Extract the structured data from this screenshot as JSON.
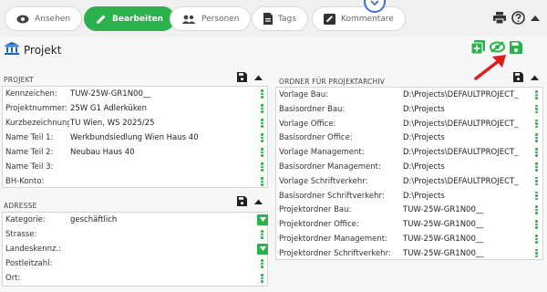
{
  "toolbar": {
    "tabs": [
      {
        "label": "Ansehen",
        "icon": "eye-icon"
      },
      {
        "label": "Bearbeiten",
        "icon": "pencil-icon",
        "active": true
      },
      {
        "label": "Personen",
        "icon": "people-icon"
      },
      {
        "label": "Tags",
        "icon": "document-icon"
      },
      {
        "label": "Kommentare",
        "icon": "comment-icon"
      }
    ],
    "right_icons": [
      "print-icon",
      "help-icon",
      "caret-up-icon"
    ]
  },
  "page": {
    "title": "Projekt",
    "title_icon": "institution-icon",
    "actions": [
      "add-icon",
      "hide-icon",
      "save-icon"
    ]
  },
  "projekt": {
    "header": "PROJEKT",
    "fields": [
      {
        "label": "Kennzeichen:",
        "value": "TUW-25W-GR1N00__"
      },
      {
        "label": "Projektnummer:",
        "value": "25W G1 Adlerküken"
      },
      {
        "label": "Kurzbezeichnung:",
        "value": "TU Wien, WS 2025/25"
      },
      {
        "label": "Name Teil 1:",
        "value": "Werkbundsiedlung Wien Haus 40"
      },
      {
        "label": "Name Teil 2:",
        "value": "Neubau Haus 40"
      },
      {
        "label": "Name Teil 3:",
        "value": ""
      },
      {
        "label": "BH-Konto:",
        "value": ""
      }
    ]
  },
  "adresse": {
    "header": "ADRESSE",
    "fields": [
      {
        "label": "Kategorie:",
        "value": "geschäftlich"
      },
      {
        "label": "Strasse:",
        "value": ""
      },
      {
        "label": "Landeskennz.:",
        "value": ""
      },
      {
        "label": "Postleitzahl:",
        "value": ""
      },
      {
        "label": "Ort:",
        "value": ""
      }
    ]
  },
  "ordner": {
    "header": "ORDNER FÜR PROJEKTARCHIV",
    "fields": [
      {
        "label": "Vorlage Bau:",
        "value": "D:\\Projects\\DEFAULTPROJECT_"
      },
      {
        "label": "Basisordner Bau:",
        "value": "D:\\Projects"
      },
      {
        "label": "Vorlage Office:",
        "value": "D:\\Projects\\DEFAULTPROJECT_"
      },
      {
        "label": "Basisordner Office:",
        "value": "D:\\Projects"
      },
      {
        "label": "Vorlage Management:",
        "value": "D:\\Projects\\DEFAULTPROJECT_"
      },
      {
        "label": "Basisordner Management:",
        "value": "D:\\Projects"
      },
      {
        "label": "Vorlage Schriftverkehr:",
        "value": "D:\\Projects\\DEFAULTPROJECT_"
      },
      {
        "label": "Basisordner Schriftverkehr:",
        "value": "D:\\Projects"
      },
      {
        "label": "Projektordner Bau:",
        "value": "TUW-25W-GR1N00__"
      },
      {
        "label": "Projektordner Office:",
        "value": "TUW-25W-GR1N00__"
      },
      {
        "label": "Projektordner Management:",
        "value": "TUW-25W-GR1N00__"
      },
      {
        "label": "Projektordner Schriftverkehr:",
        "value": "TUW-25W-GR1N00__"
      }
    ]
  },
  "colors": {
    "accent": "#2bb24c",
    "annotation_arrow": "#e01b1b",
    "annotation_circle": "#3a6fd8"
  }
}
